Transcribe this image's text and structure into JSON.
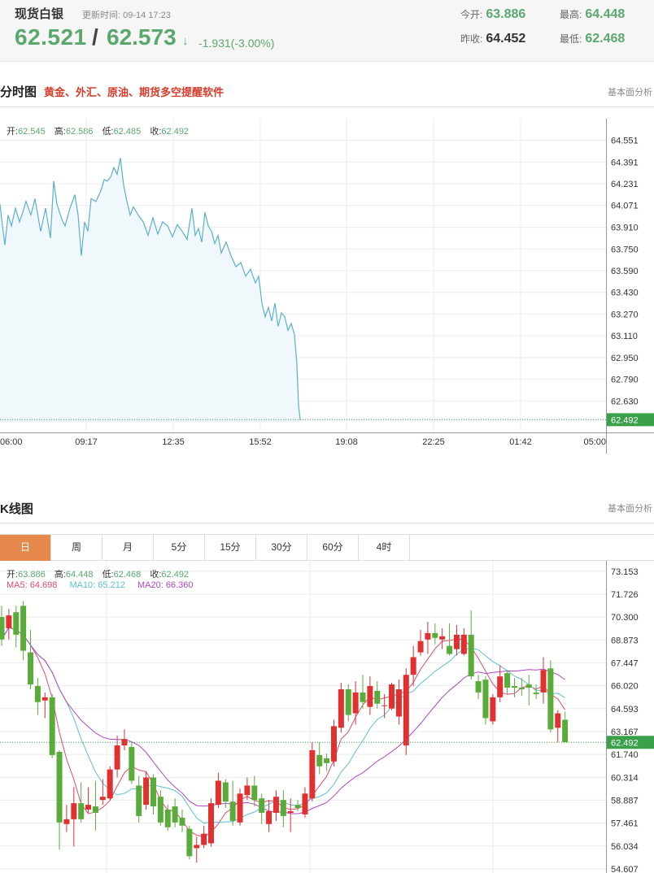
{
  "header": {
    "name": "现货白银",
    "update_label": "更新时间:",
    "update_time": "09-14 17:23",
    "bid": "62.521",
    "ask": "62.573",
    "arrow": "↓",
    "change": "-1.931(-3.00%)",
    "open_label": "今开:",
    "open_value": "63.886",
    "high_label": "最高:",
    "high_value": "64.448",
    "prev_label": "昨收:",
    "prev_value": "64.452",
    "low_label": "最低:",
    "low_value": "62.468"
  },
  "intraday": {
    "title": "分时图",
    "subtitle": "黄金、外汇、原油、期货多空提醒软件",
    "link": "基本面分析",
    "ohlc": {
      "open_label": "开:",
      "open": "62.545",
      "high_label": "高:",
      "high": "62.586",
      "low_label": "低:",
      "low": "62.485",
      "close_label": "收:",
      "close": "62.492"
    }
  },
  "kline": {
    "title": "K线图",
    "link": "基本面分析",
    "tabs": [
      "日",
      "周",
      "月",
      "5分",
      "15分",
      "30分",
      "60分",
      "4时"
    ],
    "active_tab": "日",
    "ohlc": {
      "open_label": "开:",
      "open": "63.886",
      "high_label": "高:",
      "high": "64.448",
      "low_label": "低:",
      "low": "62.468",
      "close_label": "收:",
      "close": "62.492"
    },
    "ma": {
      "ma5": "MA5: 64.698",
      "ma10": "MA10: 65.212",
      "ma20": "MA20: 66.360"
    }
  },
  "chart_data": [
    {
      "type": "area",
      "name": "intraday",
      "x_ticks": [
        "06:00",
        "09:17",
        "12:35",
        "15:52",
        "19:08",
        "22:25",
        "01:42",
        "05:00"
      ],
      "y_ticks": [
        64.551,
        64.391,
        64.231,
        64.071,
        63.91,
        63.75,
        63.59,
        63.43,
        63.27,
        63.11,
        62.95,
        62.79,
        62.63
      ],
      "ylim": [
        62.47,
        64.71
      ],
      "last_price_label": "62.492",
      "colors": {
        "line": "#5bb0cf",
        "fill": "#f1f8fc",
        "last": "#3aa14a"
      },
      "x": [
        0,
        2,
        6,
        10,
        14,
        19,
        24,
        28,
        32,
        38,
        43,
        50,
        56,
        62,
        66,
        70,
        76,
        80,
        86,
        92,
        96,
        100,
        104,
        108,
        112,
        118,
        124,
        128,
        132,
        136,
        140,
        144,
        148,
        152,
        156,
        160,
        164,
        170,
        176,
        182,
        188,
        194,
        200,
        206,
        212,
        218,
        224,
        230,
        236,
        240,
        244,
        248,
        252,
        256,
        260,
        264,
        268,
        272,
        278,
        284,
        290,
        296,
        302,
        308,
        314,
        318,
        322,
        326,
        330,
        334,
        338,
        342,
        346,
        350,
        354,
        358,
        362,
        365,
        367,
        369
      ],
      "y": [
        64.08,
        63.97,
        63.78,
        64.0,
        63.92,
        64.05,
        63.95,
        64.02,
        64.1,
        64.0,
        64.12,
        63.88,
        64.05,
        63.83,
        64.25,
        64.08,
        63.97,
        63.92,
        64.05,
        64.15,
        64.0,
        63.7,
        63.95,
        63.88,
        64.12,
        64.1,
        64.18,
        64.26,
        64.25,
        64.28,
        64.35,
        64.3,
        64.42,
        64.22,
        64.1,
        64.0,
        64.06,
        64.0,
        63.95,
        63.85,
        63.98,
        63.86,
        63.95,
        63.92,
        63.84,
        63.93,
        63.88,
        63.82,
        64.05,
        63.85,
        63.9,
        63.8,
        64.02,
        63.92,
        63.88,
        63.79,
        63.85,
        63.72,
        63.8,
        63.7,
        63.62,
        63.65,
        63.55,
        63.6,
        63.5,
        63.55,
        63.35,
        63.25,
        63.32,
        63.22,
        63.35,
        63.18,
        63.28,
        63.25,
        63.15,
        63.2,
        63.12,
        62.9,
        62.6,
        62.49
      ]
    },
    {
      "type": "candlestick",
      "name": "daily-kline",
      "y_ticks": [
        73.153,
        71.726,
        70.3,
        68.873,
        67.447,
        66.02,
        64.593,
        63.167,
        61.74,
        60.314,
        58.887,
        57.461,
        56.034,
        54.607
      ],
      "ylim": [
        54.35,
        73.8
      ],
      "last_price_label": "62.492",
      "colors": {
        "up": "#e03030",
        "down": "#5aac3a",
        "ma5": "#e24b6e",
        "ma10": "#5cbfd8",
        "ma20": "#b046c4"
      },
      "candles": [
        {
          "o": 70.3,
          "c": 68.9,
          "h": 71.0,
          "l": 68.5
        },
        {
          "o": 69.6,
          "c": 70.4,
          "h": 70.8,
          "l": 68.9
        },
        {
          "o": 70.6,
          "c": 69.2,
          "h": 71.0,
          "l": 68.4
        },
        {
          "o": 71.0,
          "c": 68.2,
          "h": 71.3,
          "l": 67.6
        },
        {
          "o": 68.1,
          "c": 66.1,
          "h": 69.5,
          "l": 65.8
        },
        {
          "o": 66.0,
          "c": 65.0,
          "h": 66.5,
          "l": 64.2
        },
        {
          "o": 65.1,
          "c": 65.3,
          "h": 65.6,
          "l": 64.0
        },
        {
          "o": 65.3,
          "c": 61.7,
          "h": 65.5,
          "l": 61.5
        },
        {
          "o": 61.9,
          "c": 57.5,
          "h": 62.0,
          "l": 55.8
        },
        {
          "o": 57.4,
          "c": 57.7,
          "h": 58.6,
          "l": 56.9
        },
        {
          "o": 57.7,
          "c": 58.7,
          "h": 59.7,
          "l": 56.0
        },
        {
          "o": 58.7,
          "c": 57.7,
          "h": 60.0,
          "l": 57.5
        },
        {
          "o": 58.3,
          "c": 58.6,
          "h": 59.7,
          "l": 58.1
        },
        {
          "o": 58.5,
          "c": 58.1,
          "h": 60.1,
          "l": 57.0
        },
        {
          "o": 58.9,
          "c": 59.1,
          "h": 60.2,
          "l": 58.6
        },
        {
          "o": 59.0,
          "c": 60.8,
          "h": 61.0,
          "l": 58.9
        },
        {
          "o": 60.8,
          "c": 62.3,
          "h": 62.9,
          "l": 60.3
        },
        {
          "o": 62.3,
          "c": 62.7,
          "h": 63.3,
          "l": 62.0
        },
        {
          "o": 62.2,
          "c": 60.1,
          "h": 62.5,
          "l": 59.9
        },
        {
          "o": 59.8,
          "c": 57.9,
          "h": 60.4,
          "l": 57.5
        },
        {
          "o": 58.6,
          "c": 60.3,
          "h": 60.7,
          "l": 58.3
        },
        {
          "o": 60.3,
          "c": 58.5,
          "h": 60.5,
          "l": 58.0
        },
        {
          "o": 59.1,
          "c": 57.5,
          "h": 59.5,
          "l": 57.3
        },
        {
          "o": 58.3,
          "c": 57.2,
          "h": 58.6,
          "l": 57.0
        },
        {
          "o": 58.5,
          "c": 57.5,
          "h": 59.0,
          "l": 57.2
        },
        {
          "o": 57.8,
          "c": 57.3,
          "h": 58.3,
          "l": 56.9
        },
        {
          "o": 57.1,
          "c": 55.4,
          "h": 57.3,
          "l": 55.2
        },
        {
          "o": 55.9,
          "c": 56.1,
          "h": 56.6,
          "l": 55.0
        },
        {
          "o": 56.1,
          "c": 56.8,
          "h": 57.3,
          "l": 55.9
        },
        {
          "o": 56.2,
          "c": 58.7,
          "h": 59.0,
          "l": 56.0
        },
        {
          "o": 58.6,
          "c": 60.1,
          "h": 60.6,
          "l": 58.4
        },
        {
          "o": 60.0,
          "c": 58.8,
          "h": 60.2,
          "l": 58.4
        },
        {
          "o": 58.8,
          "c": 57.6,
          "h": 60.1,
          "l": 57.3
        },
        {
          "o": 57.5,
          "c": 59.3,
          "h": 59.6,
          "l": 57.3
        },
        {
          "o": 59.2,
          "c": 59.8,
          "h": 60.3,
          "l": 58.9
        },
        {
          "o": 59.8,
          "c": 58.9,
          "h": 60.4,
          "l": 58.5
        },
        {
          "o": 59.0,
          "c": 58.1,
          "h": 59.3,
          "l": 57.4
        },
        {
          "o": 57.4,
          "c": 58.2,
          "h": 58.9,
          "l": 56.9
        },
        {
          "o": 58.1,
          "c": 59.1,
          "h": 59.5,
          "l": 57.6
        },
        {
          "o": 58.9,
          "c": 57.9,
          "h": 59.5,
          "l": 57.2
        },
        {
          "o": 58.1,
          "c": 58.2,
          "h": 59.0,
          "l": 56.9
        },
        {
          "o": 58.6,
          "c": 58.4,
          "h": 58.9,
          "l": 58.2
        },
        {
          "o": 58.0,
          "c": 59.3,
          "h": 59.7,
          "l": 57.8
        },
        {
          "o": 59.0,
          "c": 62.0,
          "h": 62.5,
          "l": 58.8
        },
        {
          "o": 61.7,
          "c": 61.0,
          "h": 62.5,
          "l": 60.5
        },
        {
          "o": 61.5,
          "c": 61.2,
          "h": 61.8,
          "l": 60.7
        },
        {
          "o": 61.3,
          "c": 63.5,
          "h": 63.9,
          "l": 61.0
        },
        {
          "o": 63.4,
          "c": 65.8,
          "h": 66.2,
          "l": 63.1
        },
        {
          "o": 65.8,
          "c": 64.2,
          "h": 66.1,
          "l": 63.8
        },
        {
          "o": 64.3,
          "c": 65.6,
          "h": 66.3,
          "l": 63.6
        },
        {
          "o": 65.6,
          "c": 65.0,
          "h": 66.7,
          "l": 64.6
        },
        {
          "o": 64.7,
          "c": 66.0,
          "h": 66.6,
          "l": 64.2
        },
        {
          "o": 65.7,
          "c": 64.9,
          "h": 66.3,
          "l": 64.6
        },
        {
          "o": 64.8,
          "c": 64.8,
          "h": 65.5,
          "l": 64.0
        },
        {
          "o": 64.6,
          "c": 66.1,
          "h": 66.2,
          "l": 64.5
        },
        {
          "o": 64.1,
          "c": 65.8,
          "h": 66.4,
          "l": 63.6
        },
        {
          "o": 62.3,
          "c": 66.7,
          "h": 67.1,
          "l": 61.7
        },
        {
          "o": 66.7,
          "c": 67.8,
          "h": 68.5,
          "l": 66.0
        },
        {
          "o": 68.1,
          "c": 68.8,
          "h": 69.5,
          "l": 67.9
        },
        {
          "o": 68.9,
          "c": 69.3,
          "h": 70.0,
          "l": 68.0
        },
        {
          "o": 69.3,
          "c": 69.0,
          "h": 69.9,
          "l": 68.6
        },
        {
          "o": 68.9,
          "c": 69.1,
          "h": 69.6,
          "l": 68.3
        },
        {
          "o": 68.5,
          "c": 68.0,
          "h": 69.9,
          "l": 67.9
        },
        {
          "o": 68.3,
          "c": 69.2,
          "h": 69.8,
          "l": 67.9
        },
        {
          "o": 68.0,
          "c": 69.2,
          "h": 69.6,
          "l": 67.9
        },
        {
          "o": 69.2,
          "c": 66.6,
          "h": 70.7,
          "l": 66.4
        },
        {
          "o": 66.3,
          "c": 65.6,
          "h": 66.7,
          "l": 65.2
        },
        {
          "o": 66.4,
          "c": 64.0,
          "h": 66.6,
          "l": 63.6
        },
        {
          "o": 63.8,
          "c": 65.3,
          "h": 65.5,
          "l": 63.6
        },
        {
          "o": 65.3,
          "c": 66.6,
          "h": 67.3,
          "l": 65.0
        },
        {
          "o": 66.8,
          "c": 65.9,
          "h": 67.0,
          "l": 65.5
        },
        {
          "o": 66.0,
          "c": 65.9,
          "h": 66.5,
          "l": 65.3
        },
        {
          "o": 65.9,
          "c": 65.8,
          "h": 66.5,
          "l": 65.4
        },
        {
          "o": 66.1,
          "c": 65.9,
          "h": 66.7,
          "l": 64.8
        },
        {
          "o": 65.6,
          "c": 65.5,
          "h": 66.1,
          "l": 65.2
        },
        {
          "o": 65.6,
          "c": 67.0,
          "h": 67.8,
          "l": 64.9
        },
        {
          "o": 67.1,
          "c": 63.3,
          "h": 67.6,
          "l": 63.1
        },
        {
          "o": 63.4,
          "c": 64.3,
          "h": 64.5,
          "l": 62.5
        },
        {
          "o": 63.9,
          "c": 62.5,
          "h": 64.4,
          "l": 62.5
        }
      ]
    }
  ]
}
